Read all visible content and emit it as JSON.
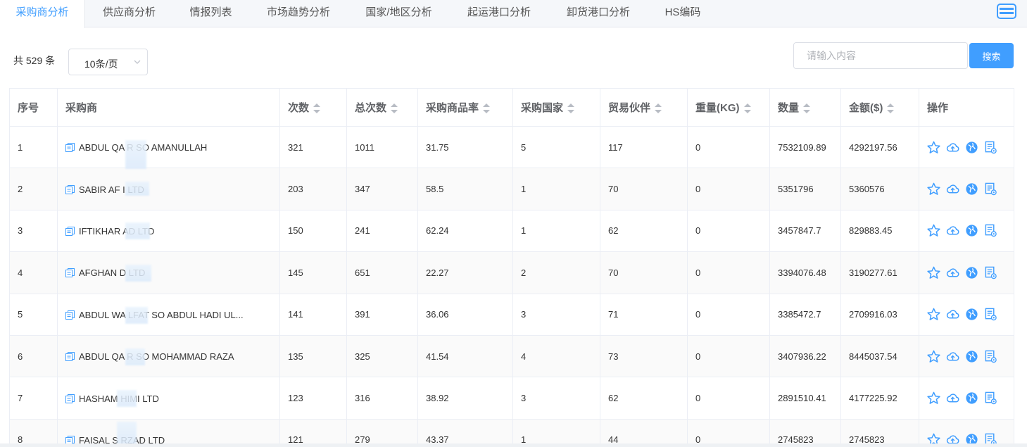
{
  "tabs": [
    {
      "label": "采购商分析",
      "active": true
    },
    {
      "label": "供应商分析",
      "active": false
    },
    {
      "label": "情报列表",
      "active": false
    },
    {
      "label": "市场趋势分析",
      "active": false
    },
    {
      "label": "国家/地区分析",
      "active": false
    },
    {
      "label": "起运港口分析",
      "active": false
    },
    {
      "label": "卸货港口分析",
      "active": false
    },
    {
      "label": "HS编码",
      "active": false
    }
  ],
  "toolbar": {
    "total_label": "共 529 条",
    "page_size": "10条/页",
    "search_placeholder": "请输入内容",
    "search_button": "搜索"
  },
  "table": {
    "headers": [
      "序号",
      "采购商",
      "次数",
      "总次数",
      "采购商品率",
      "采购国家",
      "贸易伙伴",
      "重量(KG)",
      "数量",
      "金额($)",
      "操作"
    ],
    "rows": [
      {
        "idx": "1",
        "buyer": "ABDUL QA   R SO AMANULLAH",
        "count": "321",
        "total": "1011",
        "rate": "31.75",
        "countries": "5",
        "partners": "117",
        "weight": "0",
        "qty": "7532109.89",
        "amount": "4292197.56"
      },
      {
        "idx": "2",
        "buyer": "SABIR AF     I LTD",
        "count": "203",
        "total": "347",
        "rate": "58.5",
        "countries": "1",
        "partners": "70",
        "weight": "0",
        "qty": "5351796",
        "amount": "5360576"
      },
      {
        "idx": "3",
        "buyer": "IFTIKHAR      AD LTD",
        "count": "150",
        "total": "241",
        "rate": "62.24",
        "countries": "1",
        "partners": "62",
        "weight": "0",
        "qty": "3457847.7",
        "amount": "829883.45"
      },
      {
        "idx": "4",
        "buyer": "AFGHAN D      LTD",
        "count": "145",
        "total": "651",
        "rate": "22.27",
        "countries": "2",
        "partners": "70",
        "weight": "0",
        "qty": "3394076.48",
        "amount": "3190277.61"
      },
      {
        "idx": "5",
        "buyer": "ABDUL WA     LFAT SO ABDUL HADI UL...",
        "count": "141",
        "total": "391",
        "rate": "36.06",
        "countries": "3",
        "partners": "71",
        "weight": "0",
        "qty": "3385472.7",
        "amount": "2709916.03"
      },
      {
        "idx": "6",
        "buyer": "ABDUL QA   R SO MOHAMMAD RAZA",
        "count": "135",
        "total": "325",
        "rate": "41.54",
        "countries": "4",
        "partners": "73",
        "weight": "0",
        "qty": "3407936.22",
        "amount": "8445037.54"
      },
      {
        "idx": "7",
        "buyer": "HASHAM     HIMI LTD",
        "count": "123",
        "total": "316",
        "rate": "38.92",
        "countries": "3",
        "partners": "62",
        "weight": "0",
        "qty": "2891510.41",
        "amount": "4177225.92"
      },
      {
        "idx": "8",
        "buyer": "FAISAL S    RZAD LTD",
        "count": "121",
        "total": "279",
        "rate": "43.37",
        "countries": "1",
        "partners": "44",
        "weight": "0",
        "qty": "2745823",
        "amount": "2745823"
      }
    ]
  },
  "icons": {
    "op_icons": [
      "star-icon",
      "cloud-upload-icon",
      "globe-icon",
      "report-icon"
    ],
    "buyer_icon": "document-copy-icon"
  },
  "colors": {
    "accent": "#409eff",
    "text": "#333333",
    "border": "#ebeef5"
  }
}
